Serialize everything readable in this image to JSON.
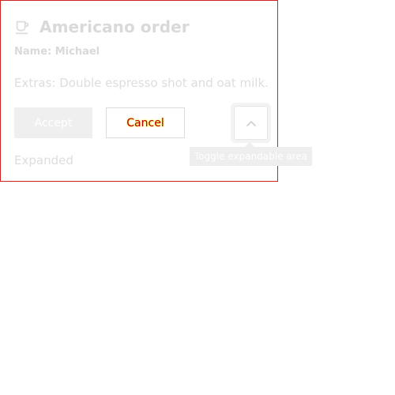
{
  "card": {
    "title": "Americano order",
    "name_line": "Name: Michael",
    "extras_line": "Extras: Double espresso shot and oat milk.",
    "expanded_text": "Expanded",
    "border_color": "#cc2222"
  },
  "actions": {
    "accept_label": "Accept",
    "cancel_label": "Cancel",
    "toggle_tooltip": "Toggle expandable area",
    "toggle_aria_label": "Toggle expandable area"
  },
  "icons": {
    "title_icon": "coffee-cup-icon",
    "toggle_icon": "chevron-up-icon"
  },
  "colors": {
    "muted_text": "#d9d9d9",
    "cancel_text": "#b30000",
    "cancel_highlight": "#ffe600",
    "accept_bg": "#efefef",
    "tooltip_bg": "#eeeeee"
  }
}
